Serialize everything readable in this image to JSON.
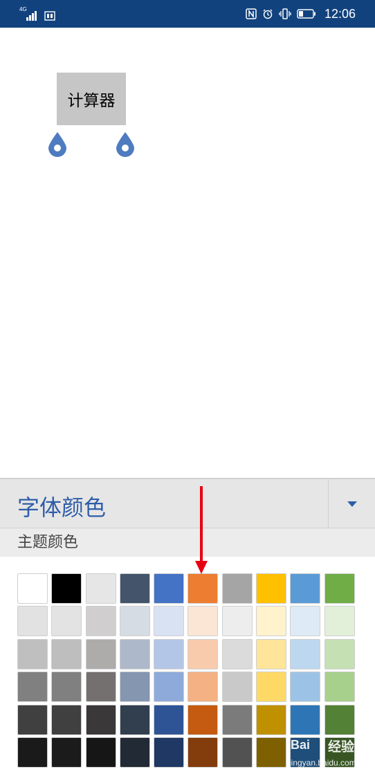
{
  "status_bar": {
    "network": "4G",
    "time": "12:06"
  },
  "document": {
    "textbox_text": "计算器"
  },
  "panel": {
    "title": "字体颜色",
    "section_label": "主题颜色",
    "swatches": [
      [
        "#ffffff",
        "#000000",
        "#e7e6e6",
        "#44546a",
        "#4472c4",
        "#ed7d31",
        "#a5a5a5",
        "#ffc000",
        "#5b9bd5",
        "#70ad47"
      ],
      [
        "#e2e2e2",
        "#e3e3e3",
        "#d0cece",
        "#d6dce4",
        "#d9e2f3",
        "#fbe5d5",
        "#ededed",
        "#fff2cc",
        "#deebf6",
        "#e2efd9"
      ],
      [
        "#bfbfbf",
        "#bebebe",
        "#aeabab",
        "#adb9ca",
        "#b4c6e7",
        "#f7cbac",
        "#dbdbdb",
        "#fee599",
        "#bdd7ee",
        "#c5e0b3"
      ],
      [
        "#808080",
        "#808080",
        "#757070",
        "#8496b0",
        "#8eaadb",
        "#f4b183",
        "#c9c9c9",
        "#ffd965",
        "#9cc3e5",
        "#a8d08d"
      ],
      [
        "#404040",
        "#404040",
        "#3a3838",
        "#323f4f",
        "#2f5496",
        "#c55a11",
        "#7b7b7b",
        "#bf9000",
        "#2e75b5",
        "#538135"
      ],
      [
        "#1a1a1a",
        "#1b1b1b",
        "#171616",
        "#222a35",
        "#1f3864",
        "#833c0b",
        "#525252",
        "#7f6000",
        "#1e4e79",
        "#375623"
      ]
    ]
  },
  "annotation": {
    "arrow_color": "#e60012"
  },
  "watermark": {
    "logo": "Bai",
    "name": "经验",
    "url": "jingyan.baidu.com"
  }
}
